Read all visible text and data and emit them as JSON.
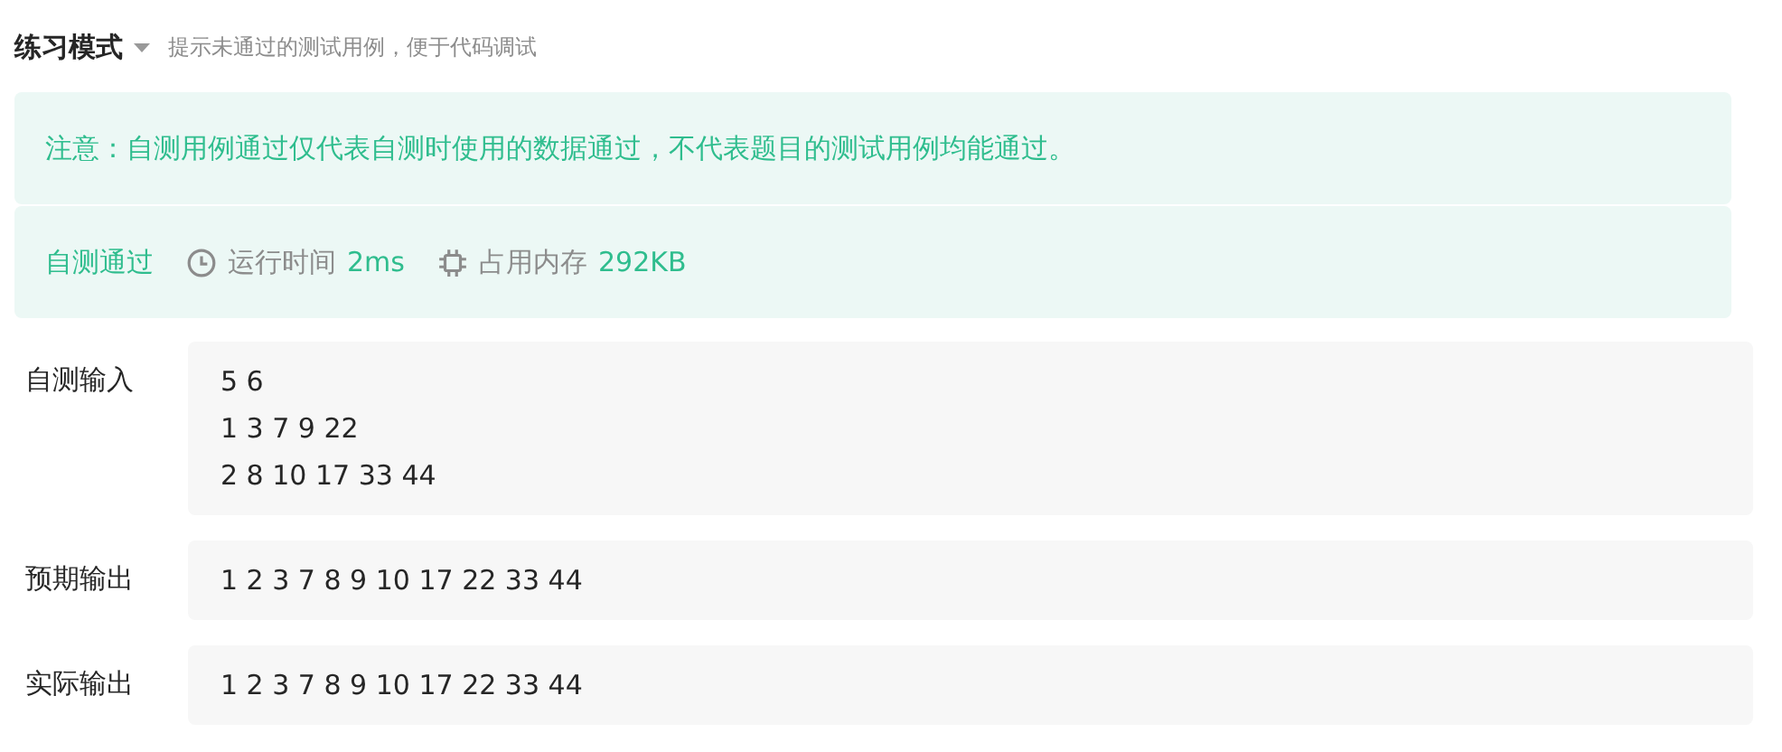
{
  "header": {
    "mode": "练习模式",
    "hint": "提示未通过的测试用例，便于代码调试"
  },
  "notice": "注意：自测用例通过仅代表自测时使用的数据通过，不代表题目的测试用例均能通过。",
  "result": {
    "status": "自测通过",
    "passed": true,
    "stats": [
      {
        "kind": "time",
        "label": "运行时间",
        "value": "2ms"
      },
      {
        "kind": "memory",
        "label": "占用内存",
        "value": "292KB"
      }
    ]
  },
  "rows": [
    {
      "label": "自测输入",
      "lines": [
        "5 6",
        "1 3 7 9 22",
        "2 8 10 17 33 44"
      ]
    },
    {
      "label": "预期输出",
      "lines": [
        "1 2 3 7 8 9 10 17 22 33 44"
      ]
    },
    {
      "label": "实际输出",
      "lines": [
        "1 2 3 7 8 9 10 17 22 33 44"
      ]
    }
  ]
}
